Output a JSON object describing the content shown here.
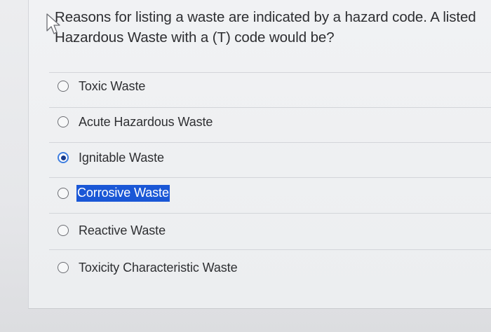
{
  "question": {
    "line1": "Reasons for listing a waste are indicated by a hazard code. A listed",
    "line2": "Hazardous Waste with a (T) code would be?"
  },
  "options": [
    {
      "label": "Toxic Waste",
      "selected": false,
      "highlighted": false
    },
    {
      "label": "Acute Hazardous Waste",
      "selected": false,
      "highlighted": false
    },
    {
      "label": "Ignitable Waste",
      "selected": true,
      "highlighted": false
    },
    {
      "label": "Corrosive Waste",
      "selected": false,
      "highlighted": true
    },
    {
      "label": "Reactive Waste",
      "selected": false,
      "highlighted": false
    },
    {
      "label": "Toxicity Characteristic Waste",
      "selected": false,
      "highlighted": false
    }
  ],
  "colors": {
    "radio_selected": "#173b8c",
    "selection_highlight": "#1a57d6"
  },
  "icons": {
    "cursor": "mouse-pointer-icon"
  }
}
